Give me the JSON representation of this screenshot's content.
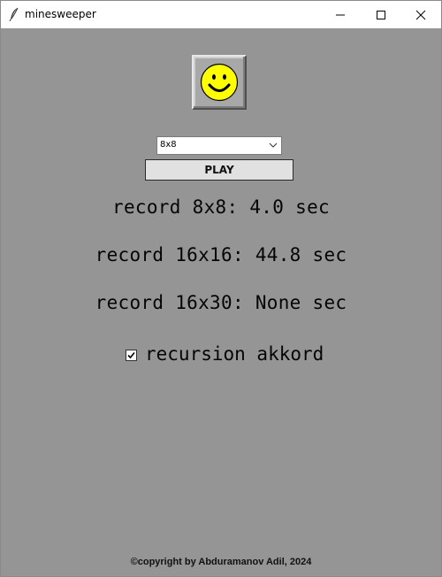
{
  "window": {
    "title": "minesweeper",
    "app_icon": "feather-icon"
  },
  "titlebar_buttons": [
    "minimize-icon",
    "maximize-icon",
    "close-icon"
  ],
  "smiley": {
    "icon": "smiley-face-icon",
    "face_color": "#ffff00"
  },
  "size_select": {
    "value": "8x8"
  },
  "play_button": {
    "label": "PLAY"
  },
  "records": [
    "record 8x8: 4.0 sec",
    "record 16x16: 44.8 sec",
    "record 16x30: None sec"
  ],
  "recursion_checkbox": {
    "label": "recursion akkord",
    "checked": true
  },
  "footer": {
    "copyright": "©copyright by Abduramanov Adil, 2024"
  },
  "colors": {
    "background": "#959595",
    "titlebar": "#ffffff",
    "button": "#e1e1e1"
  }
}
